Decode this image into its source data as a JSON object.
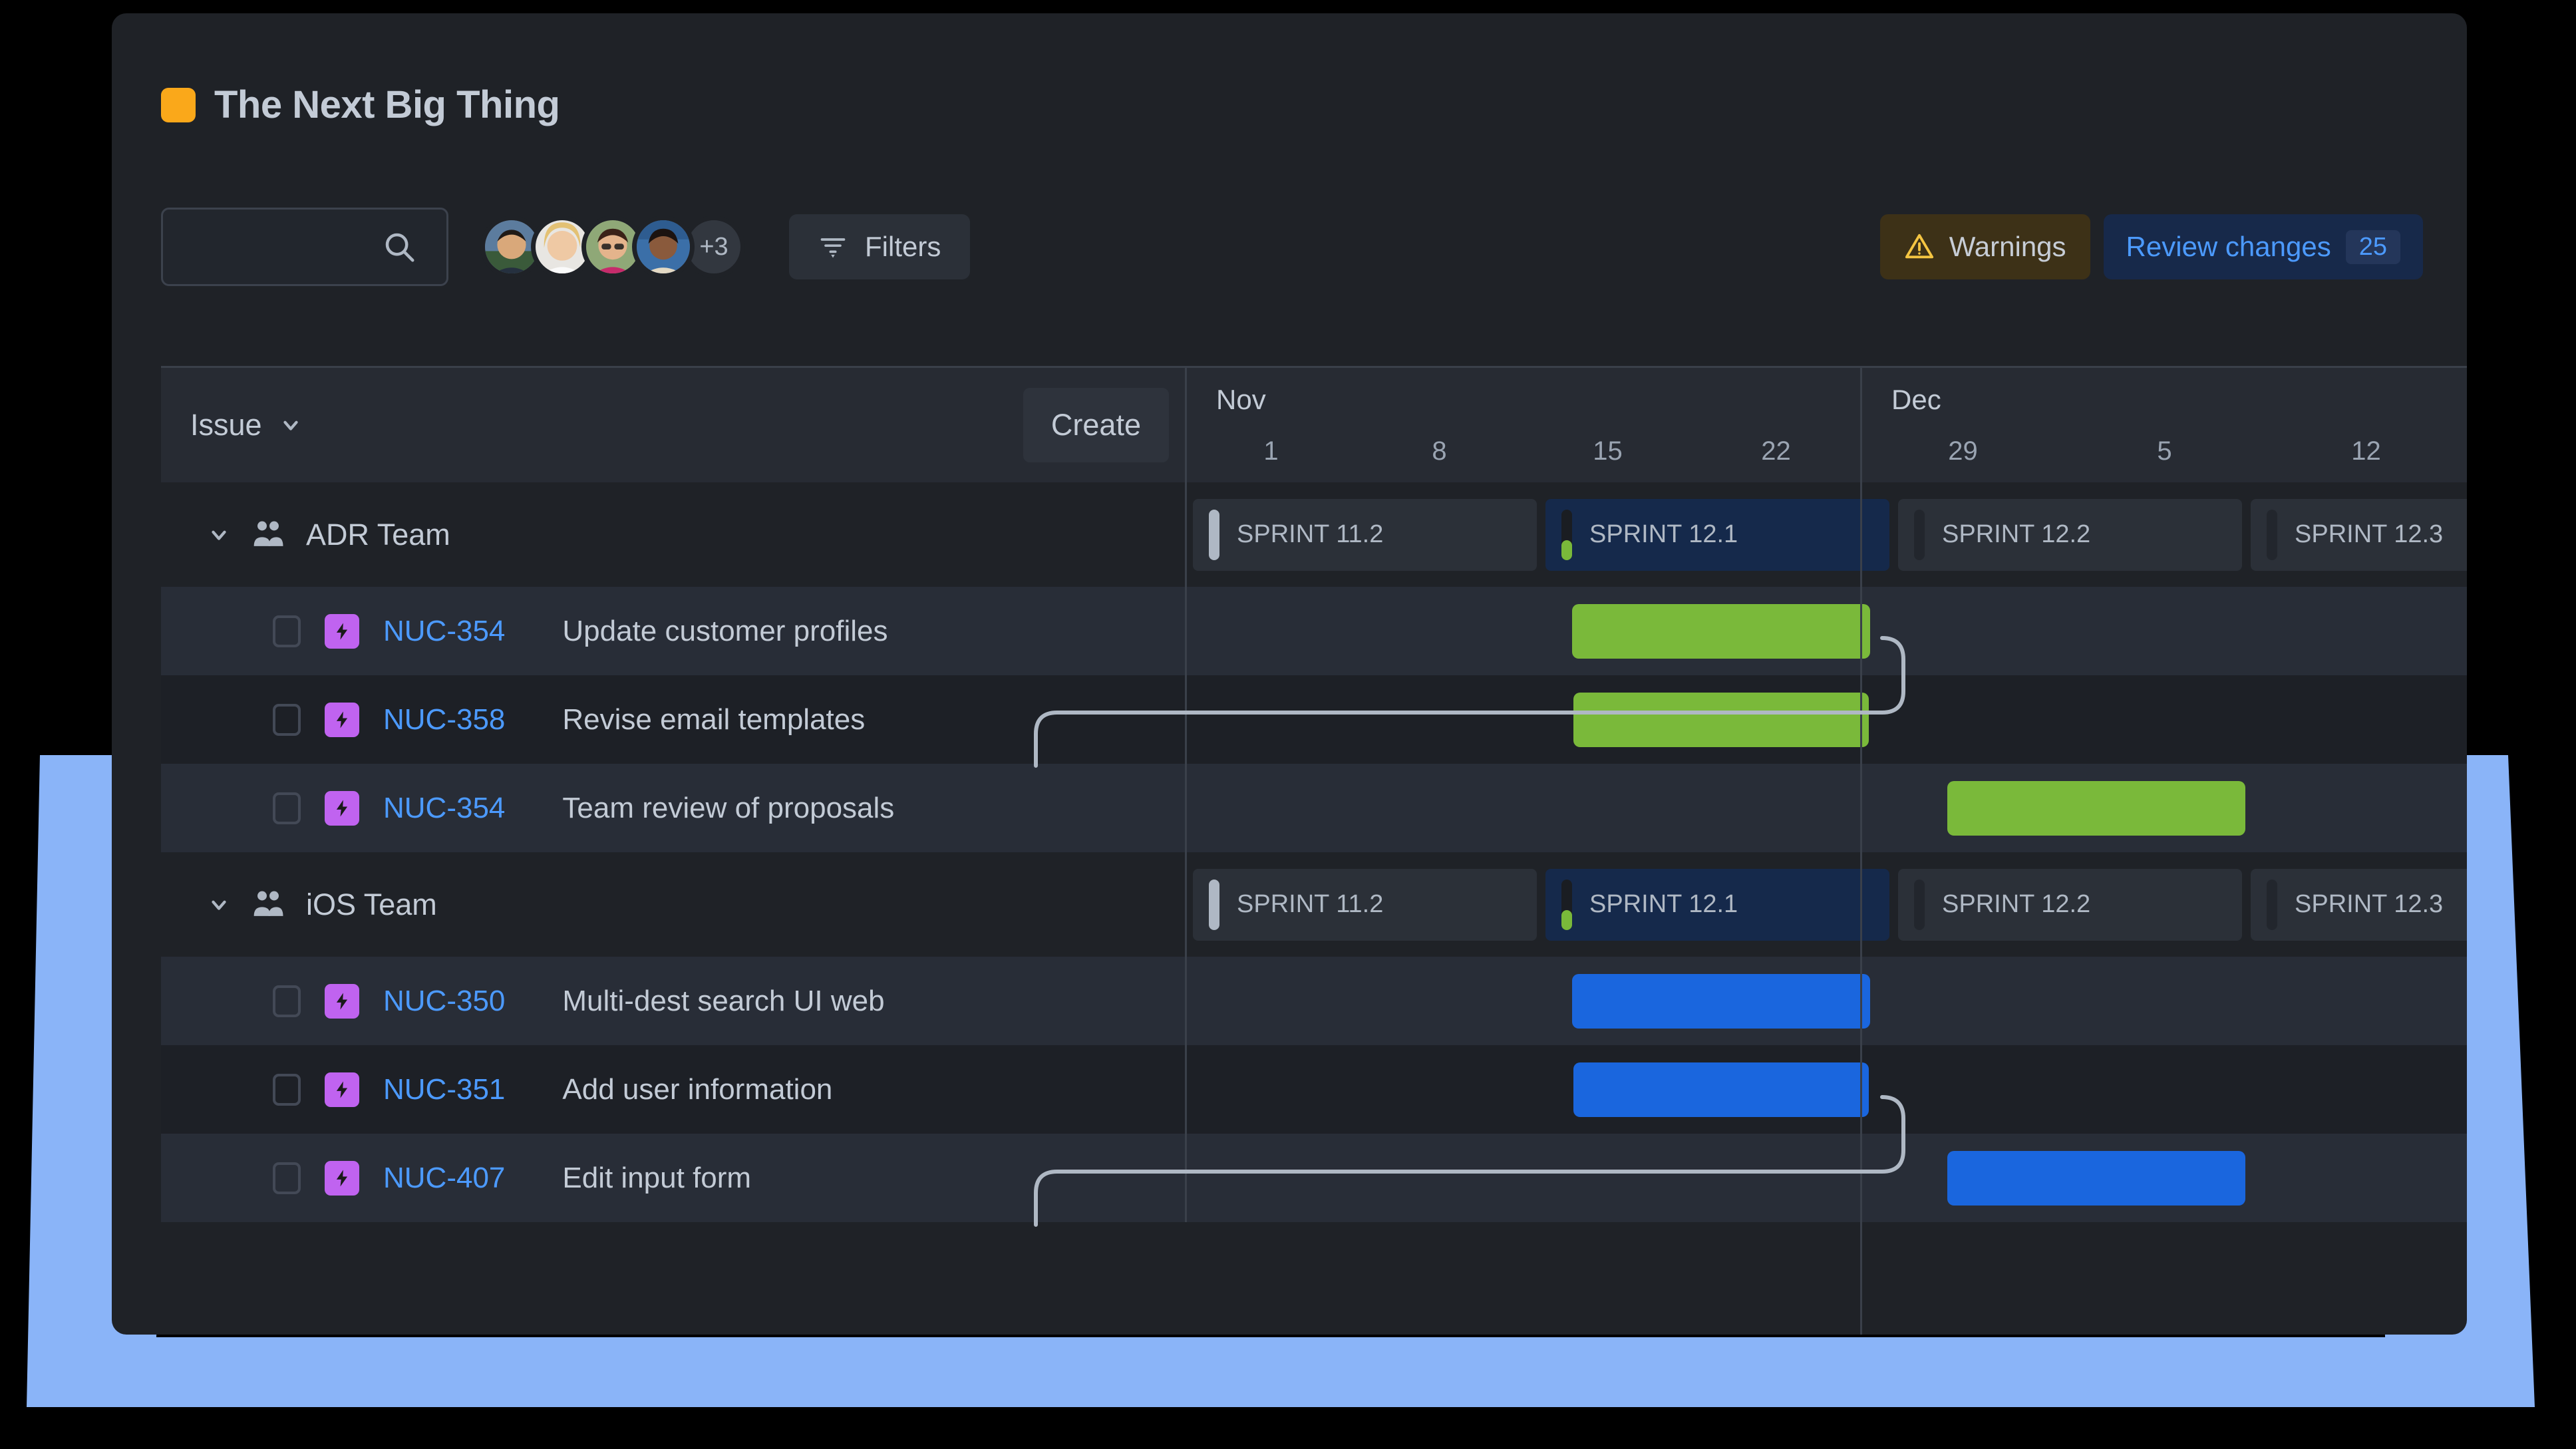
{
  "colors": {
    "accent_project": "#FAA81A",
    "bar_green": "#7AB93A",
    "bar_blue": "#1A66DE",
    "link_blue": "#4C9AFF",
    "issue_type_purple": "#C063F0",
    "card_bg": "#1F2227",
    "deco_blue": "#8AB4F8"
  },
  "header": {
    "project_title": "The Next Big Thing"
  },
  "toolbar": {
    "search_placeholder": "",
    "search_value": "",
    "search_icon": "search-icon",
    "avatar_overflow_label": "+3",
    "avatar_count": 4,
    "filters_label": "Filters",
    "filters_icon": "filter-icon",
    "warnings_label": "Warnings",
    "warnings_icon": "warning-triangle-icon",
    "review_changes_label": "Review changes",
    "review_changes_count": "25"
  },
  "grid_header": {
    "issue_select_label": "Issue",
    "issue_select_icon": "chevron-down-icon",
    "create_label": "Create",
    "months": [
      {
        "name": "Nov",
        "weeks": [
          "1",
          "8",
          "15",
          "22"
        ]
      },
      {
        "name": "Dec",
        "weeks": [
          "29",
          "5",
          "12"
        ]
      }
    ]
  },
  "sprints": [
    {
      "label": "SPRINT 11.2",
      "state": "past",
      "pill": "light"
    },
    {
      "label": "SPRINT 12.1",
      "state": "current",
      "pill": "progress"
    },
    {
      "label": "SPRINT 12.2",
      "state": "future",
      "pill": "muted"
    },
    {
      "label": "SPRINT 12.3",
      "state": "future",
      "pill": "muted"
    }
  ],
  "groups": [
    {
      "name": "ADR Team",
      "icon": "people-group-icon",
      "expanded": true,
      "expand_icon": "chevron-down-icon",
      "rows": [
        {
          "key": "NUC-354",
          "summary": "Update customer profiles",
          "type_icon": "lightning-bolt-icon",
          "checked": false,
          "bar": {
            "color": "green",
            "left_pct": 30.1,
            "width_pct": 23.3
          }
        },
        {
          "key": "NUC-358",
          "summary": "Revise email templates",
          "type_icon": "lightning-bolt-icon",
          "checked": false,
          "bar": {
            "color": "green",
            "left_pct": 30.2,
            "width_pct": 23.1
          }
        },
        {
          "key": "NUC-354",
          "summary": "Team review of proposals",
          "type_icon": "lightning-bolt-icon",
          "checked": false,
          "bar": {
            "color": "green",
            "left_pct": 59.4,
            "width_pct": 23.3
          }
        }
      ]
    },
    {
      "name": "iOS Team",
      "icon": "people-group-icon",
      "expanded": true,
      "expand_icon": "chevron-down-icon",
      "rows": [
        {
          "key": "NUC-350",
          "summary": "Multi-dest search UI web",
          "type_icon": "lightning-bolt-icon",
          "checked": false,
          "bar": {
            "color": "blue",
            "left_pct": 30.1,
            "width_pct": 23.3
          }
        },
        {
          "key": "NUC-351",
          "summary": "Add user information",
          "type_icon": "lightning-bolt-icon",
          "checked": false,
          "bar": {
            "color": "blue",
            "left_pct": 30.2,
            "width_pct": 23.1
          }
        },
        {
          "key": "NUC-407",
          "summary": "Edit input form",
          "type_icon": "lightning-bolt-icon",
          "checked": false,
          "bar": {
            "color": "blue",
            "left_pct": 59.4,
            "width_pct": 23.3
          }
        }
      ]
    }
  ]
}
